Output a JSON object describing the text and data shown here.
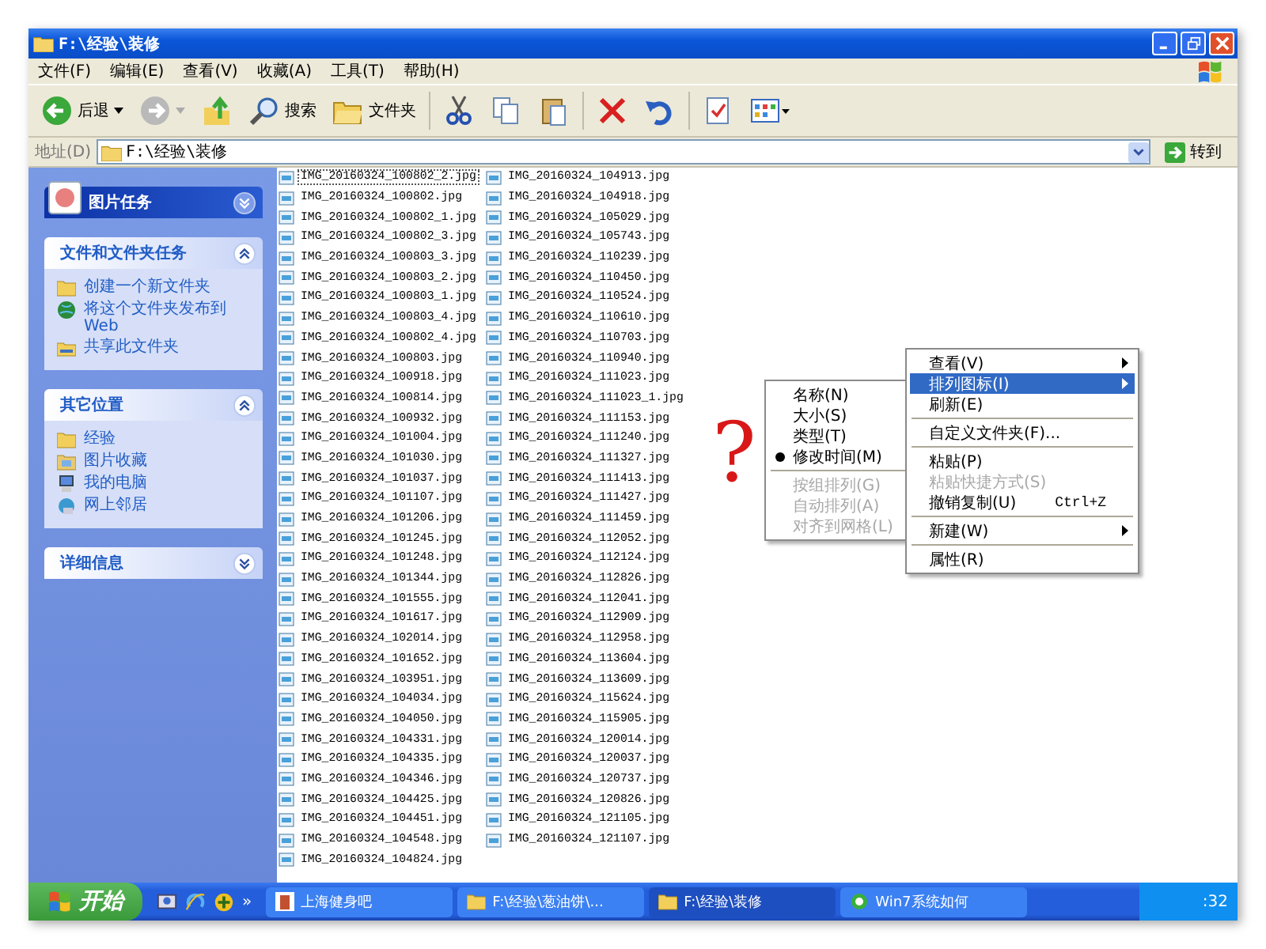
{
  "window": {
    "title": "F:\\经验\\装修"
  },
  "menu": [
    "文件(F)",
    "编辑(E)",
    "查看(V)",
    "收藏(A)",
    "工具(T)",
    "帮助(H)"
  ],
  "toolbar": [
    {
      "kind": "back",
      "label": "后退"
    },
    {
      "kind": "forward"
    },
    {
      "kind": "up"
    },
    {
      "kind": "search",
      "label": "搜索"
    },
    {
      "kind": "folders",
      "label": "文件夹"
    },
    {
      "kind": "cut"
    },
    {
      "kind": "copy"
    },
    {
      "kind": "paste"
    },
    {
      "kind": "delete"
    },
    {
      "kind": "undo"
    },
    {
      "kind": "properties"
    },
    {
      "kind": "views"
    }
  ],
  "address": {
    "label": "地址(D)",
    "value": "F:\\经验\\装修",
    "go": "转到"
  },
  "sidebar": [
    {
      "title": "图片任务",
      "expanded": false,
      "kind": "special"
    },
    {
      "title": "文件和文件夹任务",
      "expanded": true,
      "kind": "normal",
      "items": [
        {
          "label": "创建一个新文件夹",
          "kind": "newfolder"
        },
        {
          "label": "将这个文件夹发布到 Web",
          "kind": "globe"
        },
        {
          "label": "共享此文件夹",
          "kind": "share"
        }
      ]
    },
    {
      "title": "其它位置",
      "expanded": true,
      "kind": "normal",
      "items": [
        {
          "label": "经验",
          "kind": "folder"
        },
        {
          "label": "图片收藏",
          "kind": "pictures"
        },
        {
          "label": "我的电脑",
          "kind": "computer"
        },
        {
          "label": "网上邻居",
          "kind": "network"
        }
      ]
    },
    {
      "title": "详细信息",
      "expanded": false,
      "kind": "normal"
    }
  ],
  "files": [
    {
      "name": "IMG_20160324_100802_2.jpg",
      "selected": true
    },
    {
      "name": "IMG_20160324_100802.jpg",
      "selected": false
    },
    {
      "name": "IMG_20160324_100802_1.jpg",
      "selected": false
    },
    {
      "name": "IMG_20160324_100802_3.jpg",
      "selected": false
    },
    {
      "name": "IMG_20160324_100803_3.jpg",
      "selected": false
    },
    {
      "name": "IMG_20160324_100803_2.jpg",
      "selected": false
    },
    {
      "name": "IMG_20160324_100803_1.jpg",
      "selected": false
    },
    {
      "name": "IMG_20160324_100803_4.jpg",
      "selected": false
    },
    {
      "name": "IMG_20160324_100802_4.jpg",
      "selected": false
    },
    {
      "name": "IMG_20160324_100803.jpg",
      "selected": false
    },
    {
      "name": "IMG_20160324_100918.jpg",
      "selected": false
    },
    {
      "name": "IMG_20160324_100814.jpg",
      "selected": false
    },
    {
      "name": "IMG_20160324_100932.jpg",
      "selected": false
    },
    {
      "name": "IMG_20160324_101004.jpg",
      "selected": false
    },
    {
      "name": "IMG_20160324_101030.jpg",
      "selected": false
    },
    {
      "name": "IMG_20160324_101037.jpg",
      "selected": false
    },
    {
      "name": "IMG_20160324_101107.jpg",
      "selected": false
    },
    {
      "name": "IMG_20160324_101206.jpg",
      "selected": false
    },
    {
      "name": "IMG_20160324_101245.jpg",
      "selected": false
    },
    {
      "name": "IMG_20160324_101248.jpg",
      "selected": false
    },
    {
      "name": "IMG_20160324_101344.jpg",
      "selected": false
    },
    {
      "name": "IMG_20160324_101555.jpg",
      "selected": false
    },
    {
      "name": "IMG_20160324_101617.jpg",
      "selected": false
    },
    {
      "name": "IMG_20160324_102014.jpg",
      "selected": false
    },
    {
      "name": "IMG_20160324_101652.jpg",
      "selected": false
    },
    {
      "name": "IMG_20160324_103951.jpg",
      "selected": false
    },
    {
      "name": "IMG_20160324_104034.jpg",
      "selected": false
    },
    {
      "name": "IMG_20160324_104050.jpg",
      "selected": false
    },
    {
      "name": "IMG_20160324_104331.jpg",
      "selected": false
    },
    {
      "name": "IMG_20160324_104335.jpg",
      "selected": false
    },
    {
      "name": "IMG_20160324_104346.jpg",
      "selected": false
    },
    {
      "name": "IMG_20160324_104425.jpg",
      "selected": false
    },
    {
      "name": "IMG_20160324_104451.jpg",
      "selected": false
    },
    {
      "name": "IMG_20160324_104548.jpg",
      "selected": false
    },
    {
      "name": "IMG_20160324_104824.jpg",
      "selected": false
    },
    {
      "name": "IMG_20160324_104913.jpg",
      "selected": false
    },
    {
      "name": "IMG_20160324_104918.jpg",
      "selected": false
    },
    {
      "name": "IMG_20160324_105029.jpg",
      "selected": false
    },
    {
      "name": "IMG_20160324_105743.jpg",
      "selected": false
    },
    {
      "name": "IMG_20160324_110239.jpg",
      "selected": false
    },
    {
      "name": "IMG_20160324_110450.jpg",
      "selected": false
    },
    {
      "name": "IMG_20160324_110524.jpg",
      "selected": false
    },
    {
      "name": "IMG_20160324_110610.jpg",
      "selected": false
    },
    {
      "name": "IMG_20160324_110703.jpg",
      "selected": false
    },
    {
      "name": "IMG_20160324_110940.jpg",
      "selected": false
    },
    {
      "name": "IMG_20160324_111023.jpg",
      "selected": false
    },
    {
      "name": "IMG_20160324_111023_1.jpg",
      "selected": false
    },
    {
      "name": "IMG_20160324_111153.jpg",
      "selected": false
    },
    {
      "name": "IMG_20160324_111240.jpg",
      "selected": false
    },
    {
      "name": "IMG_20160324_111327.jpg",
      "selected": false
    },
    {
      "name": "IMG_20160324_111413.jpg",
      "selected": false
    },
    {
      "name": "IMG_20160324_111427.jpg",
      "selected": false
    },
    {
      "name": "IMG_20160324_111459.jpg",
      "selected": false
    },
    {
      "name": "IMG_20160324_112052.jpg",
      "selected": false
    },
    {
      "name": "IMG_20160324_112124.jpg",
      "selected": false
    },
    {
      "name": "IMG_20160324_112826.jpg",
      "selected": false
    },
    {
      "name": "IMG_20160324_112041.jpg",
      "selected": false
    },
    {
      "name": "IMG_20160324_112909.jpg",
      "selected": false
    },
    {
      "name": "IMG_20160324_112958.jpg",
      "selected": false
    },
    {
      "name": "IMG_20160324_113604.jpg",
      "selected": false
    },
    {
      "name": "IMG_20160324_113609.jpg",
      "selected": false
    },
    {
      "name": "IMG_20160324_115624.jpg",
      "selected": false
    },
    {
      "name": "IMG_20160324_115905.jpg",
      "selected": false
    },
    {
      "name": "IMG_20160324_120014.jpg",
      "selected": false
    },
    {
      "name": "IMG_20160324_120037.jpg",
      "selected": false
    },
    {
      "name": "IMG_20160324_120737.jpg",
      "selected": false
    },
    {
      "name": "IMG_20160324_120826.jpg",
      "selected": false
    },
    {
      "name": "IMG_20160324_121105.jpg",
      "selected": false
    },
    {
      "name": "IMG_20160324_121107.jpg",
      "selected": false
    }
  ],
  "annotation": "?",
  "context_menu": [
    {
      "kind": "item",
      "label": "查看(V)",
      "submenu": true,
      "selected": false,
      "disabled": false
    },
    {
      "kind": "item",
      "label": "排列图标(I)",
      "submenu": true,
      "selected": true,
      "disabled": false
    },
    {
      "kind": "item",
      "label": "刷新(E)",
      "submenu": false,
      "selected": false,
      "disabled": false
    },
    {
      "kind": "separator"
    },
    {
      "kind": "item",
      "label": "自定义文件夹(F)...",
      "submenu": false,
      "selected": false,
      "disabled": false
    },
    {
      "kind": "separator"
    },
    {
      "kind": "item",
      "label": "粘贴(P)",
      "submenu": false,
      "selected": false,
      "disabled": false
    },
    {
      "kind": "item",
      "label": "粘贴快捷方式(S)",
      "submenu": false,
      "selected": false,
      "disabled": true
    },
    {
      "kind": "item",
      "label": "撤销复制(U)",
      "shortcut": "Ctrl+Z",
      "submenu": false,
      "selected": false,
      "disabled": false
    },
    {
      "kind": "separator"
    },
    {
      "kind": "item",
      "label": "新建(W)",
      "submenu": true,
      "selected": false,
      "disabled": false
    },
    {
      "kind": "separator"
    },
    {
      "kind": "item",
      "label": "属性(R)",
      "submenu": false,
      "selected": false,
      "disabled": false
    }
  ],
  "submenu": [
    {
      "kind": "item",
      "label": "名称(N)",
      "checked": false,
      "disabled": false
    },
    {
      "kind": "item",
      "label": "大小(S)",
      "checked": false,
      "disabled": false
    },
    {
      "kind": "item",
      "label": "类型(T)",
      "checked": false,
      "disabled": false
    },
    {
      "kind": "item",
      "label": "修改时间(M)",
      "checked": true,
      "disabled": false
    },
    {
      "kind": "separator"
    },
    {
      "kind": "item",
      "label": "按组排列(G)",
      "checked": false,
      "disabled": true
    },
    {
      "kind": "item",
      "label": "自动排列(A)",
      "checked": false,
      "disabled": true
    },
    {
      "kind": "item",
      "label": "对齐到网格(L)",
      "checked": false,
      "disabled": true
    }
  ],
  "taskbar": {
    "start": "开始",
    "more": "»",
    "tasks": [
      {
        "label": "上海健身吧",
        "kind": "web",
        "selected": false
      },
      {
        "label": "F:\\经验\\葱油饼\\...",
        "kind": "folder",
        "selected": false
      },
      {
        "label": "F:\\经验\\装修",
        "kind": "folder",
        "selected": true
      },
      {
        "label": "Win7系统如何",
        "kind": "ie",
        "selected": false
      }
    ],
    "clock": ":32"
  }
}
